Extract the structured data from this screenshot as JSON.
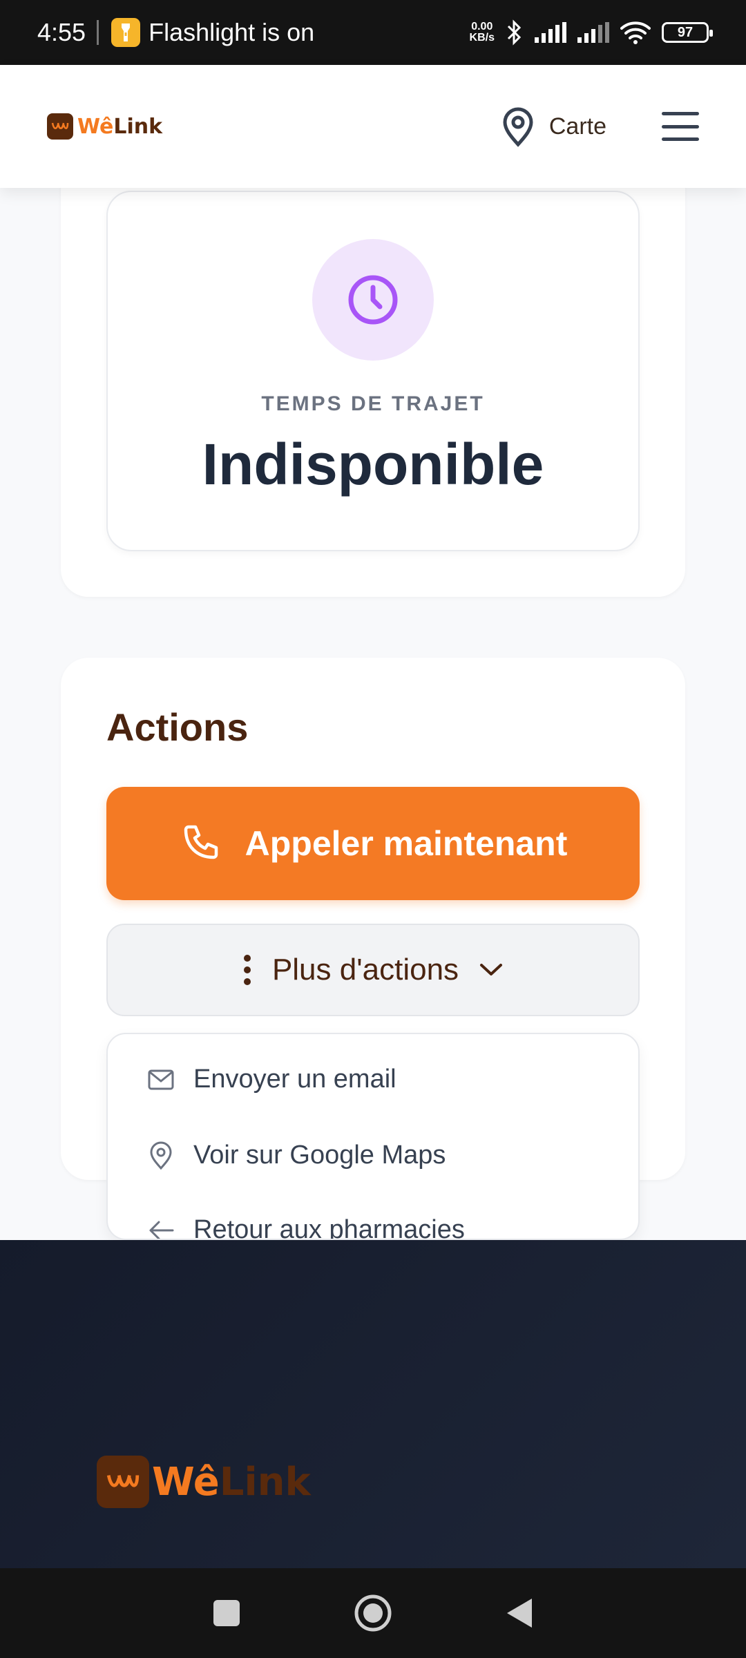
{
  "status_bar": {
    "time": "4:55",
    "notification": "Flashlight is on",
    "net_speed_value": "0.00",
    "net_speed_unit": "KB/s",
    "battery": "97"
  },
  "header": {
    "logo_text_a": "Wê",
    "logo_text_b": "Link",
    "map_label": "Carte"
  },
  "travel": {
    "label": "TEMPS DE TRAJET",
    "value": "Indisponible"
  },
  "actions": {
    "title": "Actions",
    "call_label": "Appeler maintenant",
    "more_label": "Plus d'actions",
    "items": [
      {
        "label": "Envoyer un email",
        "icon": "mail-icon"
      },
      {
        "label": "Voir sur Google Maps",
        "icon": "map-pin-icon"
      },
      {
        "label": "Retour aux pharmacies",
        "icon": "arrow-left-icon"
      }
    ]
  },
  "footer": {
    "logo_text_a": "Wê",
    "logo_text_b": "Link"
  },
  "colors": {
    "accent": "#f47a24",
    "brand_dark": "#5a2a0c",
    "clock": "#a855f7",
    "footer_bg": "#1a2132"
  }
}
